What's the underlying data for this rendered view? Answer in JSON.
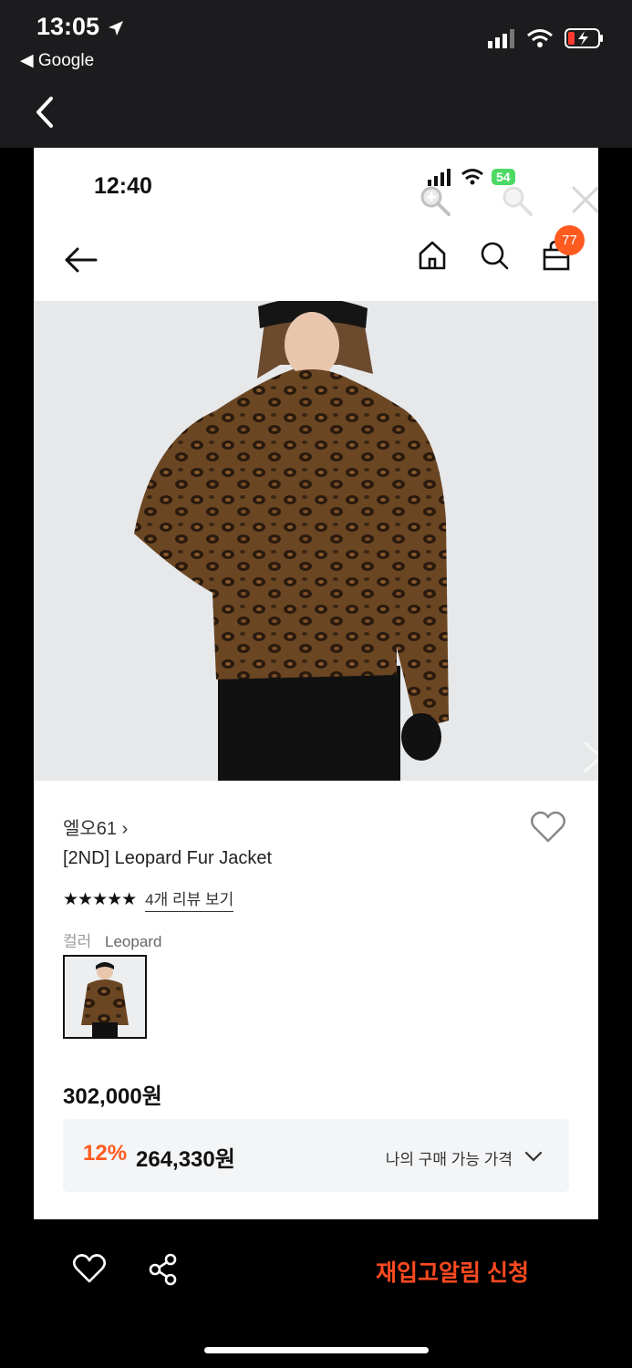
{
  "outer_status": {
    "time": "13:05",
    "back_app": "◀ Google"
  },
  "inner_status": {
    "time": "12:40",
    "battery": "54"
  },
  "nav": {
    "cart_count": "77"
  },
  "product": {
    "brand": "엘오61 ›",
    "title": "[2ND] Leopard Fur Jacket",
    "stars": "★★★★★",
    "review_link": "4개 리뷰 보기",
    "color_label": "컬러",
    "color_value": "Leopard",
    "price": "302,000원",
    "discount_rate": "12%",
    "discount_price": "264,330원",
    "my_price_label": "나의 구매 가능 가격"
  },
  "bottom": {
    "restock_label": "재입고알림 신청"
  },
  "colors": {
    "accent": "#ff5a1f",
    "battery_green": "#4cd964"
  }
}
